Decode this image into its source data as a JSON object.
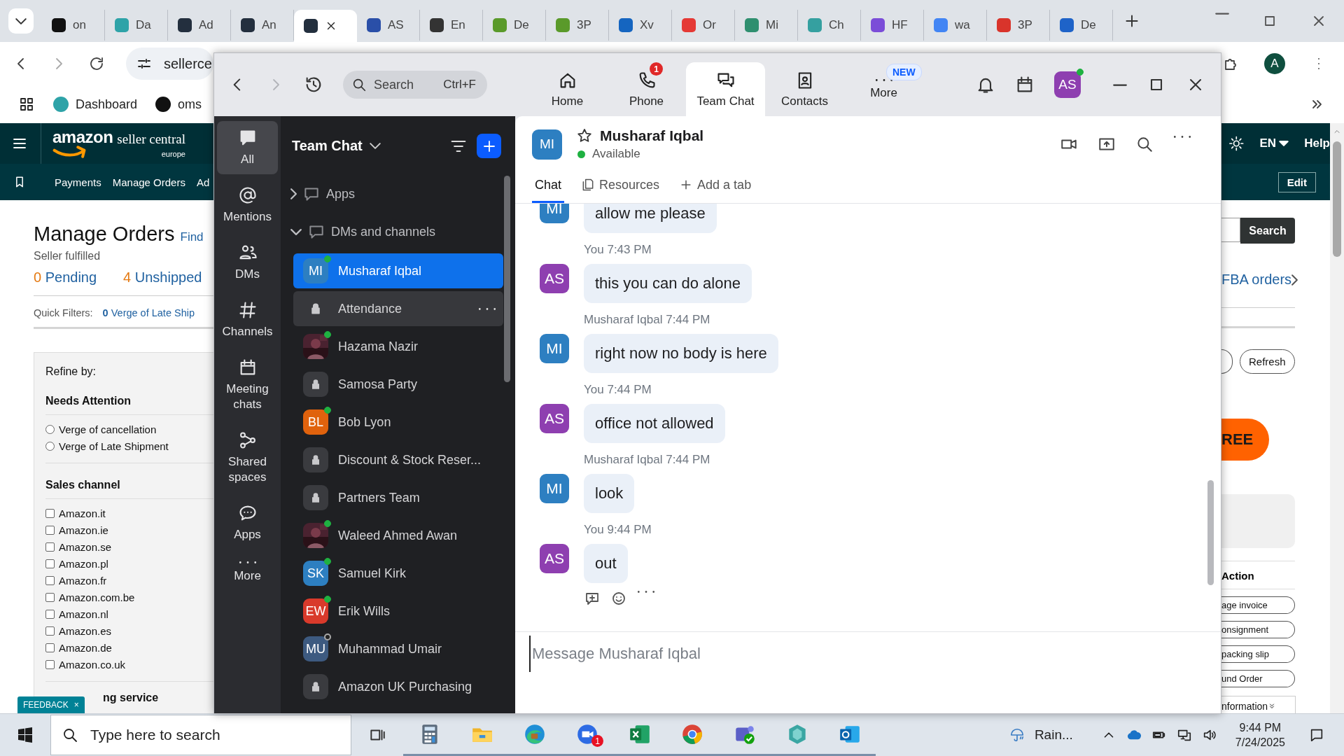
{
  "browser": {
    "tabs": [
      {
        "label": "on",
        "color": "#111111",
        "selected": false
      },
      {
        "label": "Da",
        "color": "#2ea3a8",
        "selected": false
      },
      {
        "label": "Ad",
        "color": "#232f3e",
        "selected": false
      },
      {
        "label": "An",
        "color": "#232f3e",
        "selected": false
      },
      {
        "color": "#232f3e",
        "selected": true
      },
      {
        "label": "AS",
        "color": "#2a4fa8",
        "selected": false
      },
      {
        "label": "En",
        "color": "#333333",
        "selected": false
      },
      {
        "label": "De",
        "color": "#5a9a2a",
        "selected": false
      },
      {
        "label": "3P",
        "color": "#5a9a2a",
        "selected": false
      },
      {
        "label": "Xv",
        "color": "#1565c0",
        "selected": false
      },
      {
        "label": "Or",
        "color": "#e53935",
        "selected": false
      },
      {
        "label": "Mi",
        "color": "#2f8f6f",
        "selected": false
      },
      {
        "label": "Ch",
        "color": "#35a0a0",
        "selected": false
      },
      {
        "label": "HF",
        "color": "#7b4dd8",
        "selected": false
      },
      {
        "label": "wa",
        "color": "#4285f4",
        "selected": false
      },
      {
        "label": "3P",
        "color": "#d9342b",
        "selected": false
      },
      {
        "label": "De",
        "color": "#1e63c8",
        "selected": false
      }
    ],
    "address": "sellerce",
    "profile": "A",
    "bookmarks": [
      {
        "label": "Dashboard",
        "color": "#2ea3a8"
      },
      {
        "label": "oms",
        "color": "#111111"
      }
    ]
  },
  "amazon": {
    "logo": "amazon",
    "logo_sub": "seller central",
    "logo_region": "europe",
    "nav": [
      "Payments",
      "Manage Orders",
      "Ad"
    ],
    "language": "EN",
    "help": "Help",
    "edit": "Edit",
    "title": "Manage Orders",
    "find": "Find",
    "subtitle": "Seller fulfilled",
    "counts": [
      {
        "count": "0",
        "label": "Pending"
      },
      {
        "count": "4",
        "label": "Unshipped"
      }
    ],
    "quick_filters_label": "Quick Filters:",
    "quick_filter": "**0** Verge of Late Ship",
    "refine_title": "Refine by:",
    "sections": [
      {
        "title": "Needs Attention",
        "kind": "radio",
        "options": [
          {
            "label": "Verge of cancellation",
            "checked": false
          },
          {
            "label": "Verge of Late Shipment",
            "checked": false
          }
        ]
      },
      {
        "title": "Sales channel",
        "kind": "checkbox",
        "options": [
          {
            "label": "Amazon.it",
            "checked": false
          },
          {
            "label": "Amazon.ie",
            "checked": false
          },
          {
            "label": "Amazon.se",
            "checked": false
          },
          {
            "label": "Amazon.pl",
            "checked": false
          },
          {
            "label": "Amazon.fr",
            "checked": false
          },
          {
            "label": "Amazon.com.be",
            "checked": false
          },
          {
            "label": "Amazon.nl",
            "checked": false
          },
          {
            "label": "Amazon.es",
            "checked": false
          },
          {
            "label": "Amazon.de",
            "checked": false
          },
          {
            "label": "Amazon.co.uk",
            "checked": false
          }
        ]
      }
    ],
    "cut_section": "ng service",
    "feedback": "FEEDBACK",
    "feedback_close": "×",
    "search_button": "Search",
    "fba_link": "FBA orders",
    "refresh": "Refresh",
    "promo": "REE",
    "action_header": "Action",
    "actions": [
      "age invoice",
      "onsignment",
      "packing slip",
      "und Order"
    ],
    "more_info": "nformation"
  },
  "zoom": {
    "search": {
      "placeholder": "Search",
      "shortcut": "Ctrl+F"
    },
    "nav": [
      {
        "label": "Home",
        "selected": false
      },
      {
        "label": "Phone",
        "badge": "1",
        "selected": false
      },
      {
        "label": "Team Chat",
        "selected": true
      },
      {
        "label": "Contacts",
        "selected": false
      },
      {
        "label": "More",
        "tag": "NEW",
        "selected": false
      }
    ],
    "avatar": {
      "initials": "AS",
      "color": "#8e3fb0",
      "online": true
    },
    "rail": [
      {
        "label": "All",
        "selected": true
      },
      {
        "label": "Mentions",
        "selected": false
      },
      {
        "label": "DMs",
        "selected": false
      },
      {
        "label": "Channels",
        "selected": false
      },
      {
        "label": "Meeting chats",
        "selected": false
      },
      {
        "label": "Shared spaces",
        "selected": false
      },
      {
        "label": "Apps",
        "selected": false
      },
      {
        "label": "More",
        "selected": false
      }
    ],
    "panel": {
      "title": "Team Chat",
      "sections": [
        {
          "label": "Apps",
          "expanded": false
        },
        {
          "label": "DMs and channels",
          "expanded": true,
          "children": [
            {
              "name": "Musharaf Iqbal",
              "kind": "initials",
              "initials": "MI",
              "color": "#2d7fc1",
              "online": true,
              "selected": true,
              "hovered": false
            },
            {
              "name": "Attendance",
              "kind": "lock",
              "selected": false,
              "hovered": true
            },
            {
              "name": "Hazama Nazir",
              "online": true,
              "selected": false,
              "hovered": false
            },
            {
              "name": "Samosa Party",
              "kind": "lock",
              "selected": false,
              "hovered": false
            },
            {
              "name": "Bob Lyon",
              "kind": "initials",
              "initials": "BL",
              "color": "#e0620d",
              "online": true,
              "selected": false,
              "hovered": false
            },
            {
              "name": "Discount & Stock Reser...",
              "kind": "lock",
              "selected": false,
              "hovered": false
            },
            {
              "name": "Partners Team",
              "kind": "lock",
              "selected": false,
              "hovered": false
            },
            {
              "name": "Waleed Ahmed Awan",
              "online": true,
              "selected": false,
              "hovered": false
            },
            {
              "name": "Samuel Kirk",
              "kind": "initials",
              "initials": "SK",
              "color": "#2d7fc1",
              "online": true,
              "selected": false,
              "hovered": false
            },
            {
              "name": "Erik Wills",
              "kind": "initials",
              "initials": "EW",
              "color": "#d93a2b",
              "online": true,
              "selected": false,
              "hovered": false
            },
            {
              "name": "Muhammad Umair",
              "kind": "initials",
              "initials": "MU",
              "color": "#3d5a80",
              "online": false,
              "selected": false,
              "hovered": false
            },
            {
              "name": "Amazon UK Purchasing",
              "kind": "lock",
              "selected": false,
              "hovered": false
            }
          ]
        }
      ]
    },
    "chat": {
      "contact": {
        "initials": "MI",
        "color": "#2d7fc1",
        "name": "Musharaf Iqbal",
        "status": "Available"
      },
      "tabs": [
        {
          "label": "Chat",
          "selected": true
        },
        {
          "label": "Resources",
          "selected": false
        },
        {
          "label": "Add a tab",
          "selected": false
        }
      ],
      "messages": [
        {
          "initials": "MI",
          "color": "#2d7fc1",
          "text": "allow me please"
        },
        {
          "initials": "AS",
          "color": "#8e3fb0",
          "sender": "You",
          "time": "7:43 PM",
          "text": "this you can do alone"
        },
        {
          "initials": "MI",
          "color": "#2d7fc1",
          "sender": "Musharaf Iqbal",
          "time": "7:44 PM",
          "text": "right now no body is here"
        },
        {
          "initials": "AS",
          "color": "#8e3fb0",
          "sender": "You",
          "time": "7:44 PM",
          "text": "office not allowed"
        },
        {
          "initials": "MI",
          "color": "#2d7fc1",
          "sender": "Musharaf Iqbal",
          "time": "7:44 PM",
          "text": "look"
        },
        {
          "initials": "AS",
          "color": "#8e3fb0",
          "sender": "You",
          "time": "9:44 PM",
          "text": "out"
        }
      ],
      "composer": {
        "placeholder": "Message Musharaf Iqbal"
      }
    }
  },
  "taskbar": {
    "search": {
      "placeholder": "Type here to search"
    },
    "zoom_badge": "1",
    "weather": "Rain...",
    "time": "9:44 PM",
    "date": "7/24/2025"
  }
}
